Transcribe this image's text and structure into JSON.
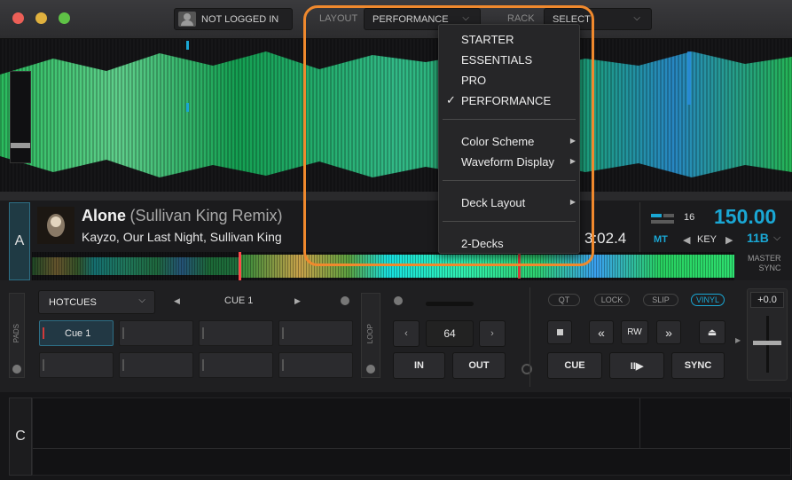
{
  "titlebar": {
    "account_label": "NOT LOGGED IN",
    "layout_label": "LAYOUT",
    "layout_value": "PERFORMANCE",
    "rack_label": "RACK",
    "rack_value": "SELECT"
  },
  "menu": {
    "items": [
      "STARTER",
      "ESSENTIALS",
      "PRO",
      "PERFORMANCE"
    ],
    "checked": "✓",
    "submenus": [
      "Color Scheme",
      "Waveform Display"
    ],
    "deck_layout": "Deck Layout",
    "decks": "2-Decks"
  },
  "deck_a": {
    "letter": "A",
    "title": "Alone",
    "remix": "(Sullivan King Remix)",
    "artist": "Kayzo, Our Last Night, Sullivan King",
    "time": "3:02.4",
    "pitch_count": "16",
    "bpm": "150.00",
    "mt": "MT",
    "key_label": "KEY",
    "key_value": "11B",
    "master": "MASTER",
    "sync": "SYNC"
  },
  "pads": {
    "side_label": "PADS",
    "mode": "HOTCUES",
    "cue_nav": "CUE 1",
    "pad1": "Cue 1",
    "loop_label": "LOOP",
    "loop_size": "64",
    "in": "IN",
    "out": "OUT"
  },
  "transport": {
    "qt": "QT",
    "lock": "LOCK",
    "slip": "SLIP",
    "vinyl": "VINYL",
    "rw": "RW",
    "cue": "CUE",
    "play": "II▶",
    "sync": "SYNC",
    "pitch": "+0.0"
  },
  "deck_c": {
    "letter": "C"
  },
  "colors": {
    "accent": "#1aa7d4",
    "highlight": "#f0892d",
    "cue_red": "#d23a3a"
  },
  "icons": [
    "user-icon",
    "chevron-down-icon",
    "checkmark-icon",
    "submenu-arrow-icon",
    "rewind-icon",
    "forward-icon",
    "stop-icon",
    "eject-icon"
  ]
}
